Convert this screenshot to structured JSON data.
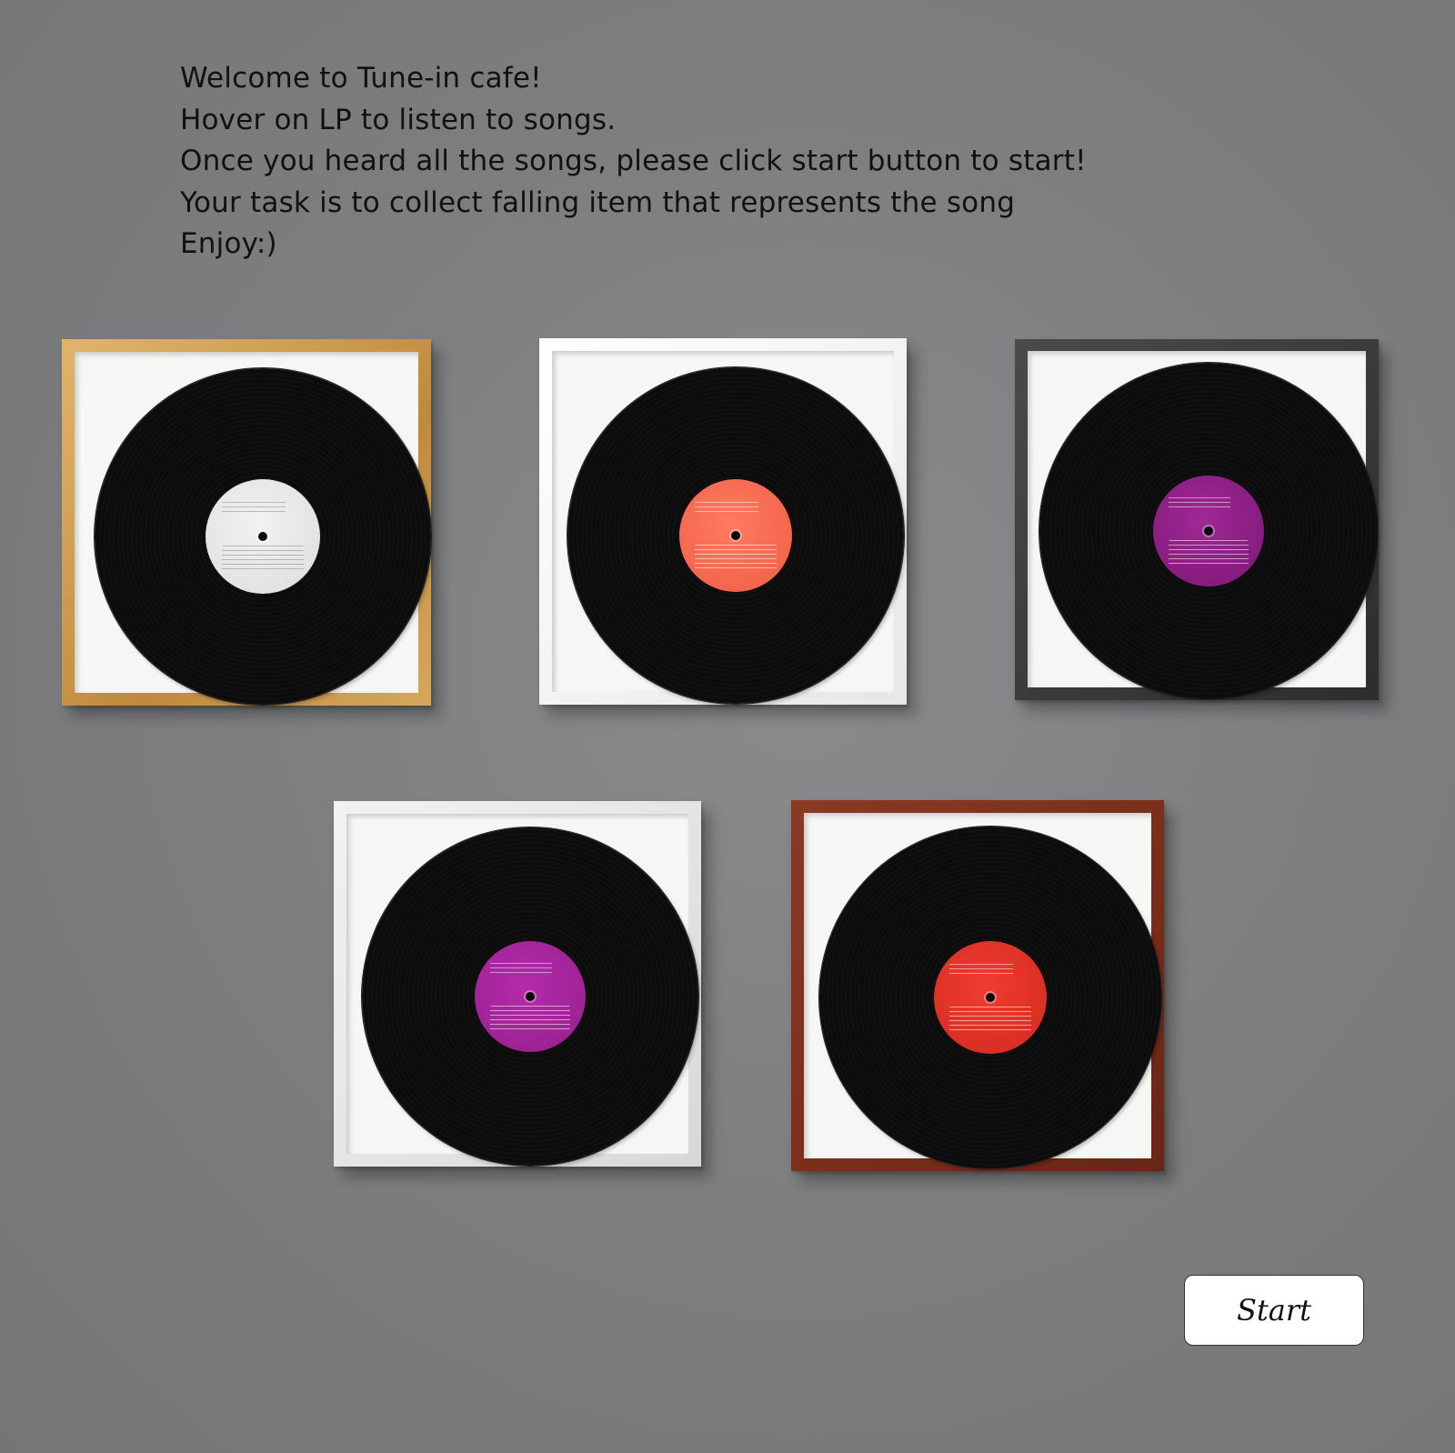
{
  "instructions": {
    "line1": "Welcome to Tune-in cafe!",
    "line2": "Hover on LP to listen to songs.",
    "line3": "Once you heard all the songs, please click start button to start!",
    "line4": "Your task is to collect falling item that represents the song",
    "line5": "Enjoy:)"
  },
  "records": [
    {
      "frame_color": "#c8923f",
      "label_color": "#e8e8e6"
    },
    {
      "frame_color": "#f2f2f2",
      "label_color": "#f26a52"
    },
    {
      "frame_color": "#3a3a39",
      "label_color": "#8e1f86"
    },
    {
      "frame_color": "#e6e6e6",
      "label_color": "#a8249e"
    },
    {
      "frame_color": "#7a2c18",
      "label_color": "#e2322a"
    }
  ],
  "start_button": {
    "label": "Start"
  }
}
